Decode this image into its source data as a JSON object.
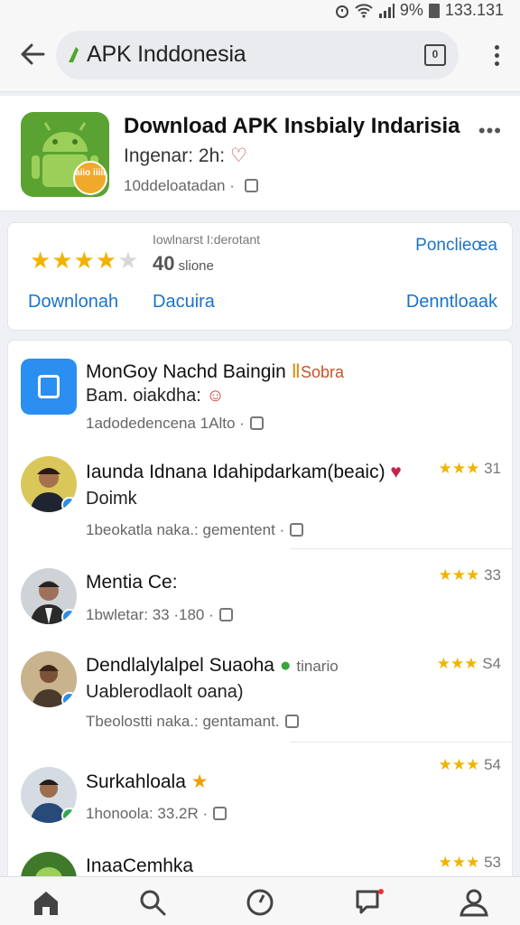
{
  "status": {
    "battery": "9%",
    "time": "133.131"
  },
  "browser": {
    "url": "APK Inddonesia",
    "tab_count": "0"
  },
  "app": {
    "title": "Download APK Insbialy Indarisia",
    "subtitle": "Ingenar: 2h:",
    "meta": "10ddeloatadan ·",
    "icon_badge": "aiio iiiii",
    "colors": {
      "icon_bg": "#5aa332",
      "badge": "#f0a92b"
    }
  },
  "rating": {
    "label": "Iowlnarst I:derotant",
    "count": "40",
    "count_suffix": "slione",
    "link_top": "Ponclieœa",
    "actions": [
      "Downlonah",
      "Dacuira",
      "Denntloaak"
    ],
    "stars_on": 4,
    "stars_total": 5,
    "colors": {
      "link": "#1a73c9",
      "star": "#f3b200"
    }
  },
  "items": [
    {
      "name": "MonGoy Nachd Baingin",
      "tag": "Sobra",
      "line2": "Bam. oiakdha:",
      "meta": "1adodedencena 1Alto ·",
      "stars": "",
      "score": ""
    },
    {
      "name": "Iaunda Idnana Idahipdarkam(beaic)",
      "line2": "Doimk",
      "meta": "1beokatla naka.: gementent ·",
      "stars": "★★★",
      "score": "31"
    },
    {
      "name": "Mentia Ce:",
      "line2": "",
      "meta": "1bwletar: 33 ·180 ·",
      "stars": "★★★",
      "score": "33"
    },
    {
      "name": "Dendlalylalpel Suaoha",
      "tag": "tinario",
      "line2": "Uablerodlaolt oana)",
      "meta": "Tbeolostti naka.: gentamant.",
      "stars": "★★★",
      "score": "S4"
    },
    {
      "name": "Surkahloala",
      "line2": "",
      "meta": "1honoola: 33.2R ·",
      "stars": "★★★",
      "score": "54"
    },
    {
      "name": "InaaCemhka",
      "line2": "",
      "meta": "",
      "stars": "★★★",
      "score": "53"
    }
  ],
  "nav": [
    "home-icon",
    "search-icon",
    "compass-icon",
    "chat-icon",
    "profile-icon"
  ]
}
